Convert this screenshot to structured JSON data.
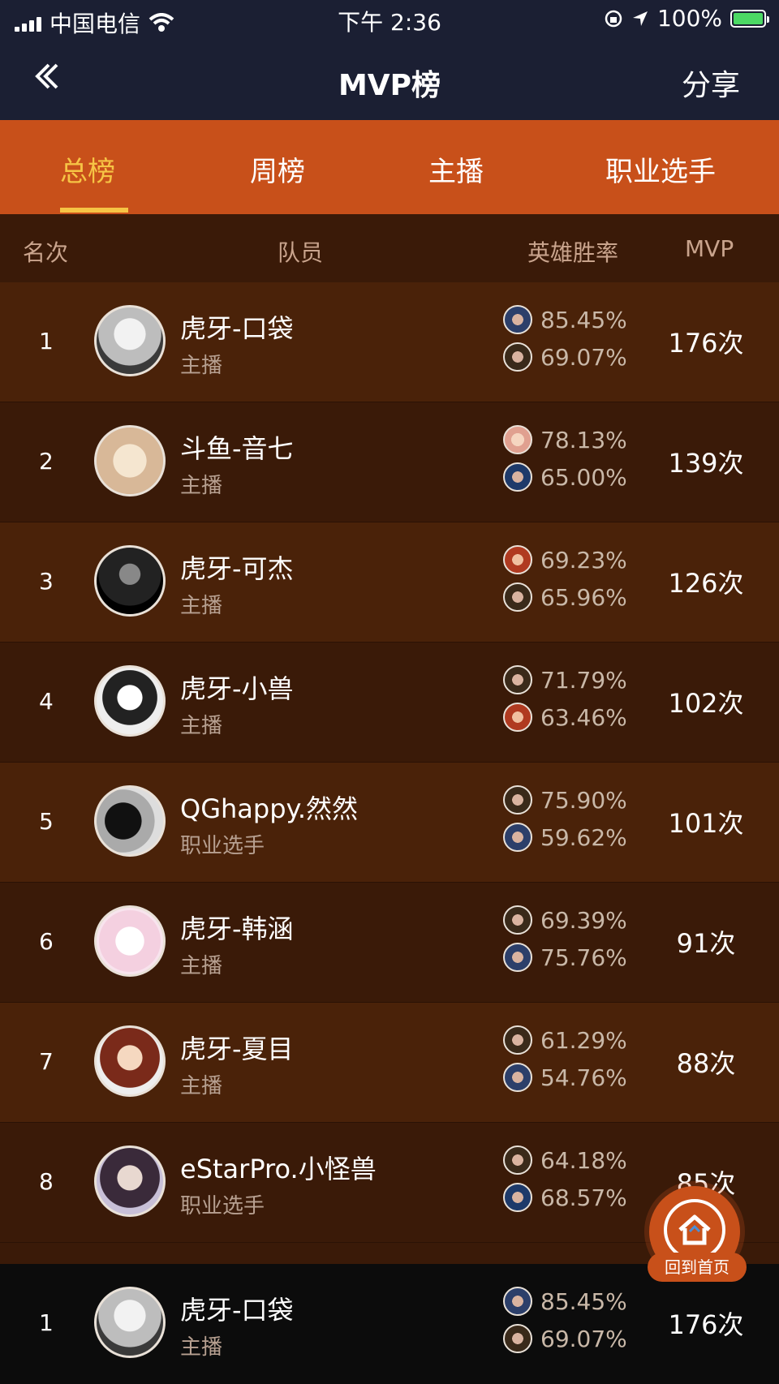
{
  "status": {
    "carrier": "中国电信",
    "time": "下午 2:36",
    "battery": "100%"
  },
  "nav": {
    "back_icon": "chevron-double-left-icon",
    "title": "MVP榜",
    "share": "分享"
  },
  "tabs": [
    {
      "label": "总榜",
      "active": true
    },
    {
      "label": "周榜",
      "active": false
    },
    {
      "label": "主播",
      "active": false
    },
    {
      "label": "职业选手",
      "active": false
    }
  ],
  "table_header": {
    "rank": "名次",
    "member": "队员",
    "winrate": "英雄胜率",
    "mvp": "MVP"
  },
  "rows": [
    {
      "rank": "1",
      "name": "虎牙-口袋",
      "role": "主播",
      "rate1": "85.45%",
      "rate2": "69.07%",
      "mvp": "176次"
    },
    {
      "rank": "2",
      "name": "斗鱼-音七",
      "role": "主播",
      "rate1": "78.13%",
      "rate2": "65.00%",
      "mvp": "139次"
    },
    {
      "rank": "3",
      "name": "虎牙-可杰",
      "role": "主播",
      "rate1": "69.23%",
      "rate2": "65.96%",
      "mvp": "126次"
    },
    {
      "rank": "4",
      "name": "虎牙-小兽",
      "role": "主播",
      "rate1": "71.79%",
      "rate2": "63.46%",
      "mvp": "102次"
    },
    {
      "rank": "5",
      "name": "QGhappy.然然",
      "role": "职业选手",
      "rate1": "75.90%",
      "rate2": "59.62%",
      "mvp": "101次"
    },
    {
      "rank": "6",
      "name": "虎牙-韩涵",
      "role": "主播",
      "rate1": "69.39%",
      "rate2": "75.76%",
      "mvp": "91次"
    },
    {
      "rank": "7",
      "name": "虎牙-夏目",
      "role": "主播",
      "rate1": "61.29%",
      "rate2": "54.76%",
      "mvp": "88次"
    },
    {
      "rank": "8",
      "name": "eStarPro.小怪兽",
      "role": "职业选手",
      "rate1": "64.18%",
      "rate2": "68.57%",
      "mvp": "85次"
    }
  ],
  "my_row": {
    "rank": "1",
    "name": "虎牙-口袋",
    "role": "主播",
    "rate1": "85.45%",
    "rate2": "69.07%",
    "mvp": "176次"
  },
  "fab": {
    "icon": "home-icon",
    "label": "回到首页"
  }
}
